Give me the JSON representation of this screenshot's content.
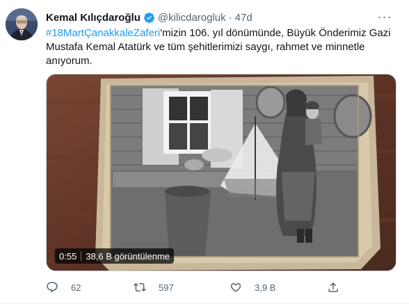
{
  "tweet": {
    "name": "Kemal Kılıçdaroğlu",
    "handle": "@kilicdarogluk",
    "separator": "·",
    "time": "47d",
    "more": "···",
    "hashtag": "#18MartÇanakkaleZaferi",
    "body": "'mizin 106. yıl dönümünde, Büyük Önderimiz Gazi Mustafa Kemal Atatürk ve tüm şehitlerimizi saygı, rahmet ve minnetle anıyorum."
  },
  "media": {
    "duration": "0:55",
    "views": "38,6 B görüntülenme"
  },
  "actions": {
    "replies": "62",
    "retweets": "597",
    "likes": "3,9 B"
  },
  "colors": {
    "link": "#1d9bf0",
    "verified": "#1d9bf0",
    "secondary_text": "#536471"
  },
  "icons": [
    "verified-badge-icon",
    "more-icon",
    "reply-icon",
    "retweet-icon",
    "like-icon",
    "share-icon"
  ]
}
